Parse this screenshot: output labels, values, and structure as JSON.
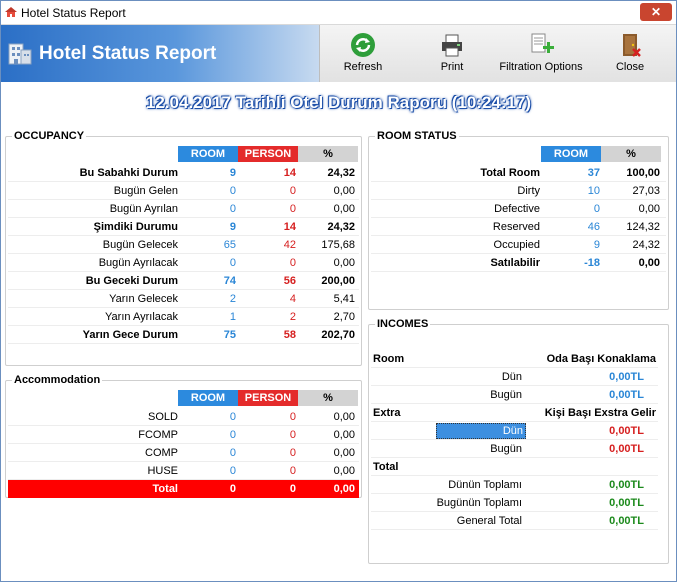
{
  "window": {
    "title": "Hotel Status Report",
    "close": "✕"
  },
  "banner": {
    "title": "Hotel Status Report"
  },
  "toolbar": {
    "refresh": "Refresh",
    "print": "Print",
    "filtration": "Filtration Options",
    "close": "Close"
  },
  "report_title": "12.04.2017 Tarihli Otel Durum Raporu (10:24:17)",
  "occupancy": {
    "label": "OCCUPANCY",
    "headers": {
      "room": "ROOM",
      "person": "PERSON",
      "pct": "%"
    },
    "rows": [
      {
        "label": "Bu Sabahki Durum",
        "room": "9",
        "person": "14",
        "pct": "24,32"
      },
      {
        "label": "Bugün Gelen",
        "room": "0",
        "person": "0",
        "pct": "0,00"
      },
      {
        "label": "Bugün Ayrılan",
        "room": "0",
        "person": "0",
        "pct": "0,00"
      },
      {
        "label": "Şimdiki Durumu",
        "room": "9",
        "person": "14",
        "pct": "24,32"
      },
      {
        "label": "Bugün Gelecek",
        "room": "65",
        "person": "42",
        "pct": "175,68"
      },
      {
        "label": "Bugün Ayrılacak",
        "room": "0",
        "person": "0",
        "pct": "0,00"
      },
      {
        "label": "Bu Geceki Durum",
        "room": "74",
        "person": "56",
        "pct": "200,00"
      },
      {
        "label": "Yarın Gelecek",
        "room": "2",
        "person": "4",
        "pct": "5,41"
      },
      {
        "label": "Yarın Ayrılacak",
        "room": "1",
        "person": "2",
        "pct": "2,70"
      },
      {
        "label": "Yarın Gece Durum",
        "room": "75",
        "person": "58",
        "pct": "202,70"
      }
    ]
  },
  "accommodation": {
    "label": "Accommodation",
    "headers": {
      "room": "ROOM",
      "person": "PERSON",
      "pct": "%"
    },
    "rows": [
      {
        "label": "SOLD",
        "room": "0",
        "person": "0",
        "pct": "0,00"
      },
      {
        "label": "FCOMP",
        "room": "0",
        "person": "0",
        "pct": "0,00"
      },
      {
        "label": "COMP",
        "room": "0",
        "person": "0",
        "pct": "0,00"
      },
      {
        "label": "HUSE",
        "room": "0",
        "person": "0",
        "pct": "0,00"
      }
    ],
    "total": {
      "label": "Total",
      "room": "0",
      "person": "0",
      "pct": "0,00"
    }
  },
  "room_status": {
    "label": "ROOM STATUS",
    "headers": {
      "room": "ROOM",
      "pct": "%"
    },
    "rows": [
      {
        "label": "Total Room",
        "room": "37",
        "pct": "100,00"
      },
      {
        "label": "Dirty",
        "room": "10",
        "pct": "27,03"
      },
      {
        "label": "Defective",
        "room": "0",
        "pct": "0,00"
      },
      {
        "label": "Reserved",
        "room": "46",
        "pct": "124,32"
      },
      {
        "label": "Occupied",
        "room": "9",
        "pct": "24,32"
      },
      {
        "label": "Satılabilir",
        "room": "-18",
        "pct": "0,00"
      }
    ]
  },
  "incomes": {
    "label": "INCOMES",
    "room_title": "Room",
    "room_col": "Oda Başı Konaklama",
    "room_rows": [
      {
        "label": "Dün",
        "value": "0,00TL"
      },
      {
        "label": "Bugün",
        "value": "0,00TL"
      }
    ],
    "extra_title": "Extra",
    "extra_col": "Kişi Başı Exstra Gelir",
    "extra_rows": [
      {
        "label": "Dün",
        "value": "0,00TL"
      },
      {
        "label": "Bugün",
        "value": "0,00TL"
      }
    ],
    "total_title": "Total",
    "total_rows": [
      {
        "label": "Dünün Toplamı",
        "value": "0,00TL"
      },
      {
        "label": "Bugünün Toplamı",
        "value": "0,00TL"
      },
      {
        "label": "General Total",
        "value": "0,00TL"
      }
    ]
  },
  "colors": {
    "room": "#2c8ade",
    "person": "#e42b2b",
    "total_row": "#ff0000",
    "income_green": "#1c8a1c"
  }
}
